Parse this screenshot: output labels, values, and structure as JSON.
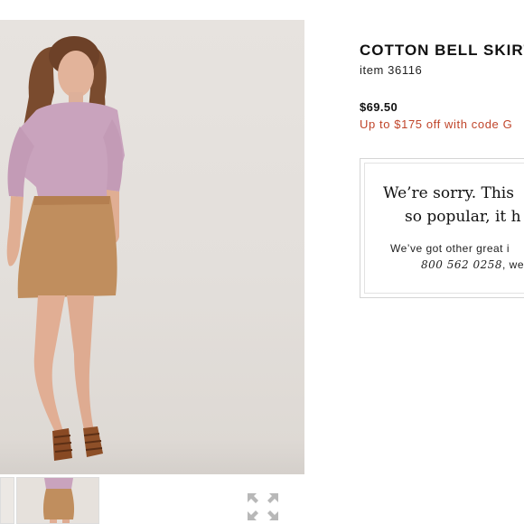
{
  "product": {
    "title": "COTTON BELL SKIRT",
    "item_number": "item 36116",
    "price": "$69.50",
    "promo": "Up to $175 off with code G"
  },
  "notice": {
    "line1": "We’re sorry. This",
    "line2": "so popular, it h",
    "line3": "We’ve got other great i",
    "phone": "800 562 0258",
    "line4_suffix": ", we’r"
  },
  "gallery": {
    "main_image": "model-wearing-skirt-photo",
    "thumbnails": [
      "thumbnail-partial",
      "thumbnail-model"
    ],
    "expand_icon": "expand-arrows-icon"
  },
  "colors": {
    "accent_red": "#c0452a",
    "sweater": "#c9a3bd",
    "skirt": "#c08e5e",
    "background_photo": "#e4e0dc"
  }
}
